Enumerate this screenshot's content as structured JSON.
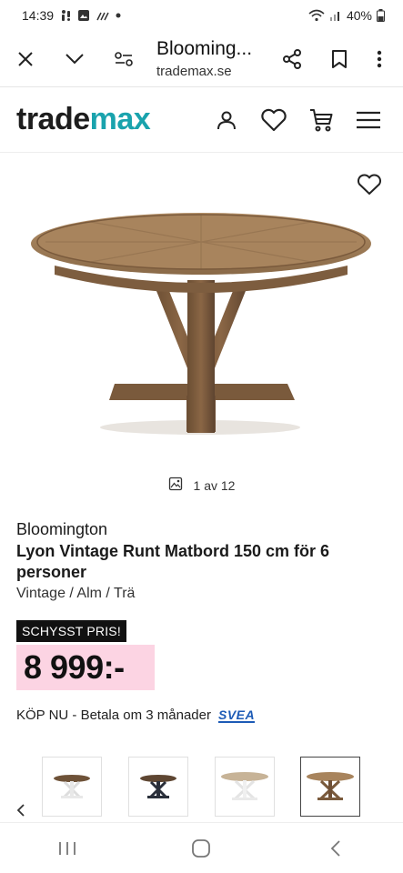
{
  "status_bar": {
    "time": "14:39",
    "battery": "40%"
  },
  "browser": {
    "title": "Blooming...",
    "url": "trademax.se",
    "icons": [
      "close-icon",
      "chevron-down-icon",
      "site-settings-icon",
      "share-icon",
      "bookmark-icon",
      "more-vert-icon"
    ]
  },
  "site": {
    "logo_part1": "trade",
    "logo_part2": "max",
    "icons": [
      "user-icon",
      "heart-icon",
      "cart-icon",
      "menu-icon"
    ],
    "brand_color": "#1aa3ad"
  },
  "gallery": {
    "counter": "1 av 12",
    "thumbnails": [
      {
        "name": "table-white-legs"
      },
      {
        "name": "table-black-legs"
      },
      {
        "name": "table-white-base"
      },
      {
        "name": "table-wood-base"
      }
    ],
    "active_index": 3
  },
  "product": {
    "brand": "Bloomington",
    "title": "Lyon Vintage Runt Matbord 150 cm för 6 personer",
    "breadcrumb": "Vintage / Alm / Trä",
    "badge": "SCHYSST PRIS!",
    "price": "8 999:-",
    "installment": "KÖP NU - Betala om 3 månader",
    "installment_provider": "SVEA",
    "price_bg_color": "#fcd4e3"
  },
  "nav": {
    "icons": [
      "recent-apps-icon",
      "home-icon",
      "back-icon"
    ]
  }
}
